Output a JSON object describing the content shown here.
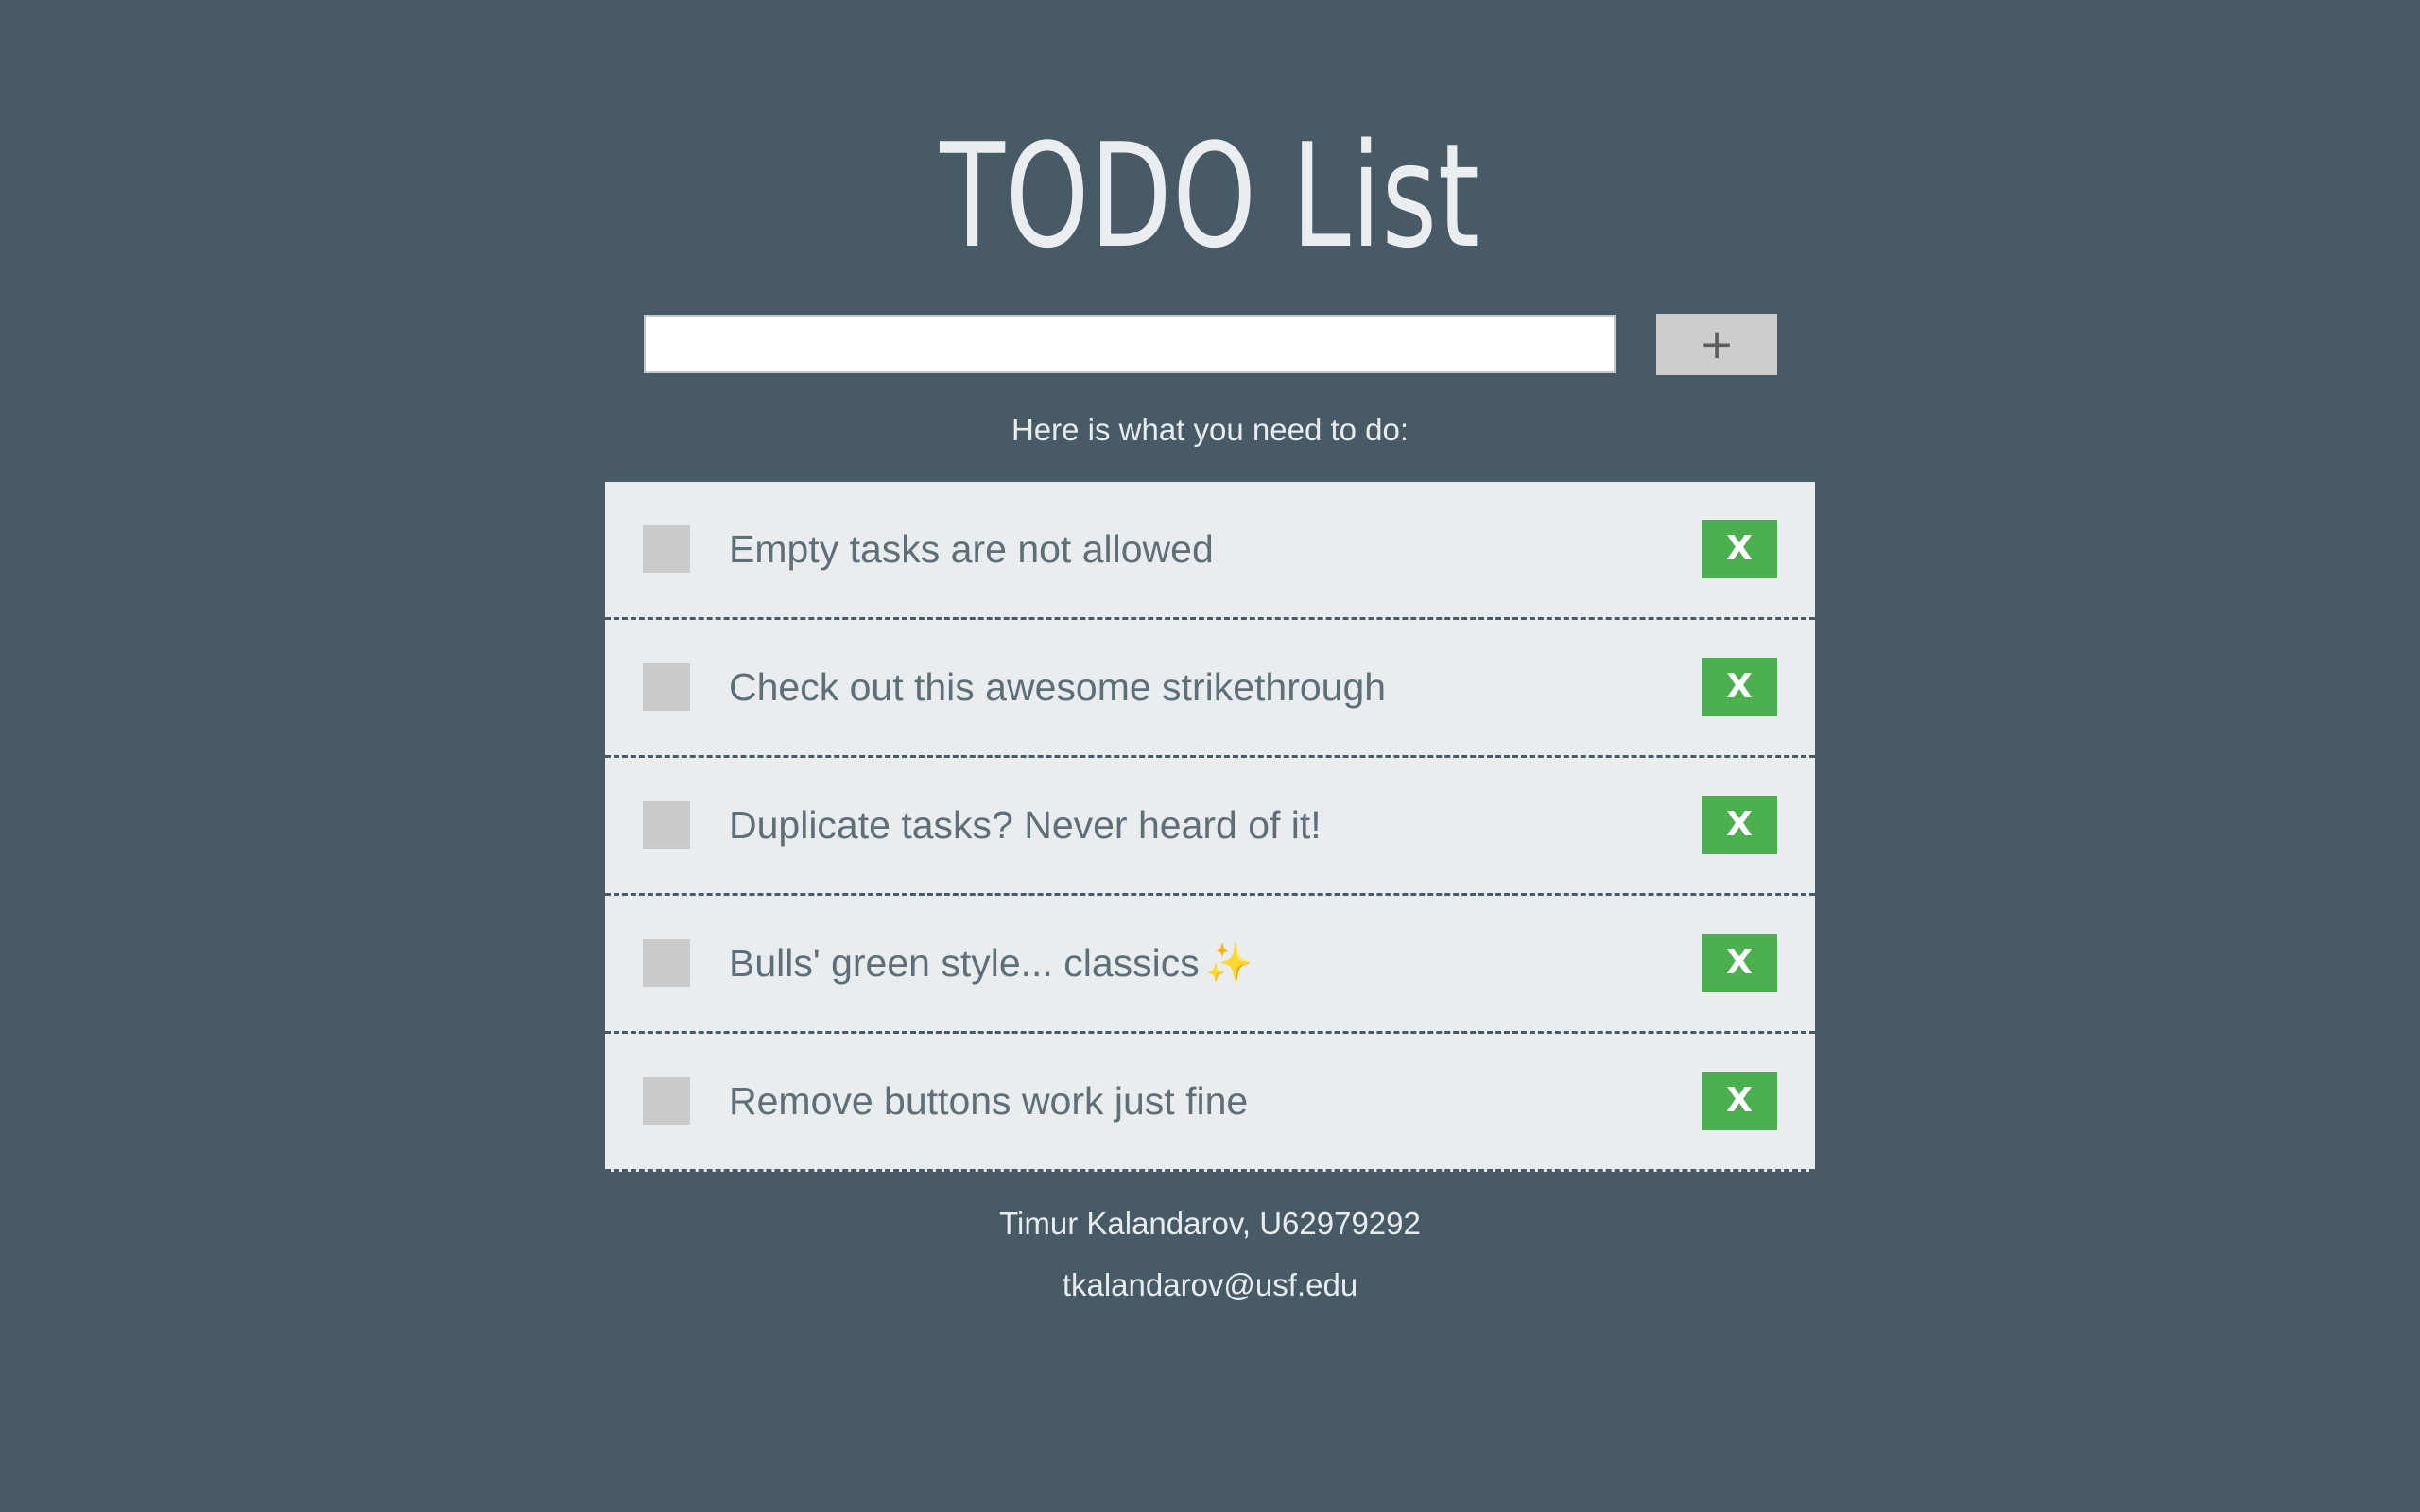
{
  "header": {
    "title": "TODO List"
  },
  "new_task": {
    "value": "",
    "add_label": "+"
  },
  "subtitle": "Here is what you need to do:",
  "todos": [
    {
      "text": "Empty tasks are not allowed",
      "checked": false,
      "remove_label": "X"
    },
    {
      "text": "Check out this awesome strikethrough",
      "checked": false,
      "remove_label": "X"
    },
    {
      "text": "Duplicate tasks? Never heard of it!",
      "checked": false,
      "remove_label": "X"
    },
    {
      "text": "Bulls' green style... classics",
      "icon": "sparkles-icon",
      "icon_glyph": "✨",
      "checked": false,
      "remove_label": "X"
    },
    {
      "text": "Remove buttons work just fine",
      "checked": false,
      "remove_label": "X"
    }
  ],
  "footer": {
    "author": "Timur Kalandarov, U62979292",
    "email": "tkalandarov@usf.edu"
  },
  "colors": {
    "background": "#475a66",
    "item_background": "#eaedf0",
    "remove_button": "#4caf50",
    "checkbox": "#cbcbcb",
    "add_button": "#cdcdcd"
  }
}
